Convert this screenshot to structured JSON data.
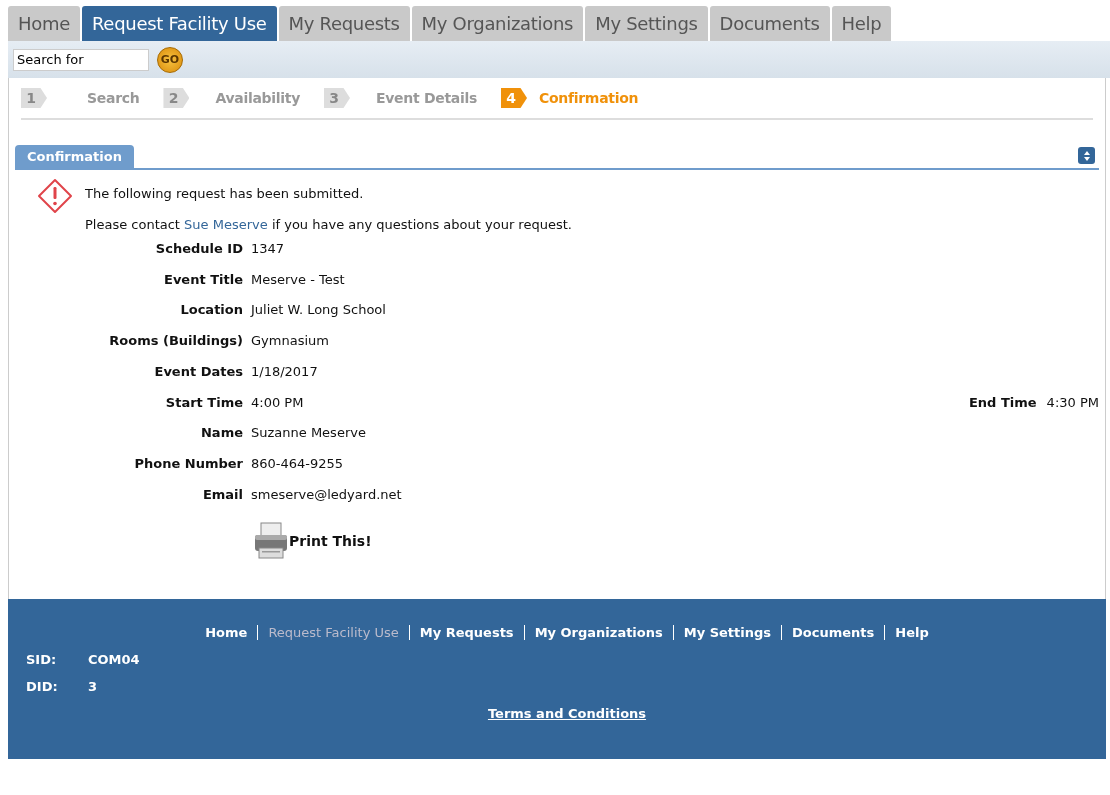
{
  "tabs": [
    {
      "label": "Home",
      "selected": false
    },
    {
      "label": "Request Facility Use",
      "selected": true
    },
    {
      "label": "My Requests",
      "selected": false
    },
    {
      "label": "My Organizations",
      "selected": false
    },
    {
      "label": "My Settings",
      "selected": false
    },
    {
      "label": "Documents",
      "selected": false
    },
    {
      "label": "Help",
      "selected": false
    }
  ],
  "search": {
    "value": "Search for",
    "button": "GO"
  },
  "steps": [
    {
      "number": "1",
      "label": "Search",
      "selected": false
    },
    {
      "number": "2",
      "label": "Availability",
      "selected": false
    },
    {
      "number": "3",
      "label": "Event Details",
      "selected": false
    },
    {
      "number": "4",
      "label": "Confirmation",
      "selected": true
    }
  ],
  "panel": {
    "title": "Confirmation",
    "message": "The following request has been submitted.",
    "contact": {
      "before": "Please contact",
      "link": "Sue Meserve",
      "after": "if you have any questions about your request."
    },
    "fields": [
      {
        "label": "Schedule ID",
        "value": "1347"
      },
      {
        "label": "Event Title",
        "value": "Meserve - Test"
      },
      {
        "label": "Location",
        "value": "Juliet W. Long School"
      },
      {
        "label": "Rooms (Buildings)",
        "value": "Gymnasium"
      },
      {
        "label": "Event Dates",
        "value": "1/18/2017"
      },
      {
        "label": "Start Time",
        "value": "4:00 PM",
        "extra_label": "End Time",
        "extra_value": "4:30 PM"
      },
      {
        "label": "Name",
        "value": "Suzanne Meserve"
      },
      {
        "label": "Phone Number",
        "value": "860-464-9255"
      },
      {
        "label": "Email",
        "value": "smeserve@ledyard.net"
      }
    ],
    "print": "Print This!"
  },
  "footer": {
    "links": [
      {
        "label": "Home",
        "selected": false
      },
      {
        "label": "Request Facility Use",
        "selected": true
      },
      {
        "label": "My Requests",
        "selected": false
      },
      {
        "label": "My Organizations",
        "selected": false
      },
      {
        "label": "My Settings",
        "selected": false
      },
      {
        "label": "Documents",
        "selected": false
      },
      {
        "label": "Help",
        "selected": false
      }
    ],
    "info": [
      {
        "label": "SID:",
        "value": "COM04"
      },
      {
        "label": "DID:",
        "value": "3"
      }
    ],
    "terms": "Terms and Conditions"
  }
}
